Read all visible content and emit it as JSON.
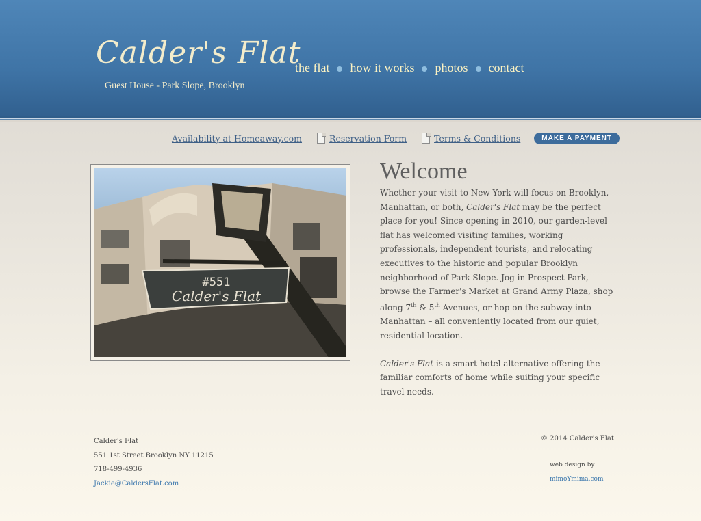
{
  "site": {
    "name": "Calder's Flat",
    "tagline": "Guest House - Park Slope, Brooklyn"
  },
  "nav": {
    "items": [
      {
        "label": "the flat"
      },
      {
        "label": "how it works"
      },
      {
        "label": "photos"
      },
      {
        "label": "contact"
      }
    ]
  },
  "links": {
    "availability": "Availability at Homeaway.com",
    "reservation": "Reservation Form",
    "terms": "Terms & Conditions",
    "payment": "MAKE A PAYMENT"
  },
  "photo": {
    "sign_number": "#551",
    "sign_name": "Calder's Flat"
  },
  "welcome": {
    "title": "Welcome",
    "p1_a": "Whether your visit to New York will focus on Brooklyn, Manhattan, or both, ",
    "p1_em": "Calder's Flat",
    "p1_b": " may be the perfect place for you!  Since opening in 2010, our garden-level flat has welcomed visiting families, working professionals, independent tourists, and relocating executives to the historic and popular Brooklyn neighborhood of Park Slope.  Jog in Prospect Park, browse the Farmer's Market at Grand Army Plaza, shop along 7",
    "p1_sup1": "th",
    "p1_c": " & 5",
    "p1_sup2": "th",
    "p1_d": " Avenues, or hop on the subway into Manhattan – all conveniently located from our quiet, residential location.",
    "p2_em": "Calder's Flat",
    "p2_b": " is a smart hotel alternative offering the familiar comforts of home while suiting your specific travel needs."
  },
  "footer": {
    "name": "Calder's Flat",
    "address": "551 1st Street Brooklyn NY 11215",
    "phone": "718-499-4936",
    "email": "Jackie@CaldersFlat.com",
    "copyright": "© 2014 Calder's Flat",
    "design_label": "web design by",
    "design_link": "mimoYmima.com"
  },
  "colors": {
    "header_blue": "#4a80b2",
    "logo_cream": "#f3eccb",
    "nav_dot": "#8fbedf",
    "link_blue": "#3e5f86",
    "button_blue": "#3d6c9c"
  }
}
